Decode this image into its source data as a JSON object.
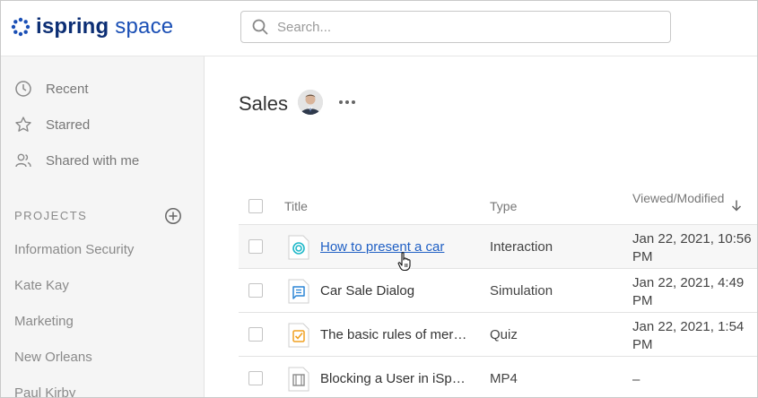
{
  "brand": {
    "word1": "ispring",
    "word2": "space"
  },
  "search": {
    "placeholder": "Search..."
  },
  "sidebar": {
    "nav": [
      {
        "label": "Recent",
        "icon": "clock-icon"
      },
      {
        "label": "Starred",
        "icon": "star-icon"
      },
      {
        "label": "Shared with me",
        "icon": "people-icon"
      }
    ],
    "projects_heading": "PROJECTS",
    "projects": [
      "Information Security",
      "Kate Kay",
      "Marketing",
      "New Orleans",
      "Paul Kirby"
    ]
  },
  "main": {
    "title": "Sales",
    "columns": {
      "title": "Title",
      "type": "Type",
      "viewed": "Viewed/Modified"
    },
    "rows": [
      {
        "name": "How to present a car",
        "type": "Interaction",
        "date": "Jan 22, 2021, 10:56 PM",
        "icon": "interaction-icon",
        "color": "#1fb8c9"
      },
      {
        "name": "Car Sale Dialog",
        "type": "Simulation",
        "date": "Jan 22, 2021, 4:49 PM",
        "icon": "simulation-icon",
        "color": "#2d86d6"
      },
      {
        "name": "The basic rules of merchandising",
        "type": "Quiz",
        "date": "Jan 22, 2021, 1:54 PM",
        "icon": "quiz-icon",
        "color": "#f0a020"
      },
      {
        "name": "Blocking a User in iSpring Learn",
        "type": "MP4",
        "date": "–",
        "icon": "video-icon",
        "color": "#8a8a8a"
      }
    ]
  },
  "colors": {
    "brand_dark": "#0c2e74",
    "brand": "#1a4fb5",
    "link": "#1f5fc4",
    "sidebar_bg": "#f5f5f5"
  }
}
